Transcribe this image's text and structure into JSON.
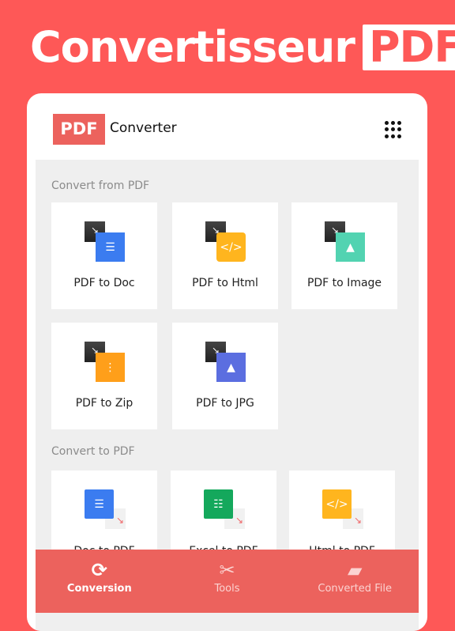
{
  "hero": {
    "title": "Convertisseur",
    "badge": "PDF"
  },
  "header": {
    "logo": "PDF",
    "title": "Converter",
    "menu_icon": "grid-dots-icon"
  },
  "sections": [
    {
      "title": "Convert from PDF",
      "items": [
        {
          "label": "PDF to Doc",
          "icon": "doc-icon",
          "color": "#3b7cf0",
          "glyph": "☰"
        },
        {
          "label": "PDF to Html",
          "icon": "html-code-icon",
          "color": "#ffb51e",
          "glyph": "</>"
        },
        {
          "label": "PDF to Image",
          "icon": "image-icon",
          "color": "#52d3b1",
          "glyph": "▲"
        },
        {
          "label": "PDF to Zip",
          "icon": "zip-icon",
          "color": "#ff9f1a",
          "glyph": "⋮"
        },
        {
          "label": "PDF to JPG",
          "icon": "jpg-image-icon",
          "color": "#5b6ee0",
          "glyph": "▲"
        }
      ]
    },
    {
      "title": "Convert to PDF",
      "items": [
        {
          "label": "Doc to PDF",
          "icon": "doc-icon",
          "color": "#3b7cf0",
          "glyph": "☰"
        },
        {
          "label": "Excel to PDF",
          "icon": "excel-icon",
          "color": "#14a85c",
          "glyph": "☷"
        },
        {
          "label": "Html to PDF",
          "icon": "html-code-icon",
          "color": "#ffb51e",
          "glyph": "</>"
        }
      ]
    }
  ],
  "nav": [
    {
      "label": "Conversion",
      "icon": "refresh-icon",
      "glyph": "⟳",
      "active": true
    },
    {
      "label": "Tools",
      "icon": "tools-icon",
      "glyph": "✂",
      "active": false
    },
    {
      "label": "Converted File",
      "icon": "folder-icon",
      "glyph": "▰",
      "active": false
    }
  ]
}
